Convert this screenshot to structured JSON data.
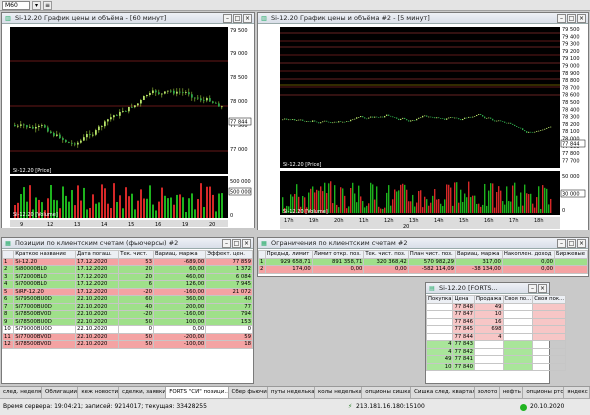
{
  "toolbar": {
    "timeframe": "M60"
  },
  "chart1": {
    "title": "Si-12.20 График цены и объёма - [60 минут]",
    "price_label": "Si-12.20 [Price]",
    "volume_label": "Si-12.20 [Volume]",
    "price_ticks": [
      "79 500",
      "79 000",
      "78 500",
      "78 000",
      "77 500",
      "77 000"
    ],
    "current_price": "77 844",
    "price_tag": "78 000",
    "volume_ticks": [
      "500 000",
      "0"
    ],
    "volume_tag": "500 000",
    "time_ticks": [
      "9",
      "12",
      "13",
      "14",
      "15",
      "16",
      "19",
      "20"
    ]
  },
  "chart2": {
    "title": "Si-12.20 График цены и объёма #2 - [5 минут]",
    "price_label": "Si-12.20 [Price]",
    "volume_label": "Si-12.20 [Volume]",
    "price_ticks": [
      "79 500",
      "79 400",
      "79 300",
      "79 200",
      "79 100",
      "79 000",
      "78 900",
      "78 800",
      "78 700",
      "78 600",
      "78 500",
      "78 400",
      "78 300",
      "78 200",
      "78 100",
      "78 000",
      "77 900",
      "77 800",
      "77 700"
    ],
    "current_price": "77 844",
    "volume_ticks": [
      "50 000",
      "0"
    ],
    "volume_tag": "30 000",
    "time_ticks": [
      "17h",
      "19h",
      "20h",
      "11h",
      "12h",
      "13h",
      "14h",
      "15h",
      "16h",
      "17h",
      "18h"
    ],
    "time_date": "20"
  },
  "positions": {
    "title": "Позиции по клиентским счетам (фьючерсы) #2",
    "columns": [
      "",
      "Краткое название",
      "Дата погаш.",
      "Тек. чист.",
      "Вариац. маржа",
      "Эффект. цен."
    ],
    "rows": [
      {
        "n": "1",
        "name": "Si-12.20",
        "date": "17.12.2020",
        "qty": "53",
        "var": "-689,00",
        "eff": "77 859",
        "color": "red"
      },
      {
        "n": "2",
        "name": "Si80000BL0",
        "date": "17.12.2020",
        "qty": "20",
        "var": "60,00",
        "eff": "1 372",
        "color": "green"
      },
      {
        "n": "3",
        "name": "Si72000BL0",
        "date": "17.12.2020",
        "qty": "20",
        "var": "460,00",
        "eff": "6 084",
        "color": "green"
      },
      {
        "n": "4",
        "name": "Si70000BL0",
        "date": "17.12.2020",
        "qty": "6",
        "var": "126,00",
        "eff": "7 945",
        "color": "green"
      },
      {
        "n": "5",
        "name": "SiRF-12.20",
        "date": "17.12.2020",
        "qty": "-20",
        "var": "-160,00",
        "eff": "21 072",
        "color": "red"
      },
      {
        "n": "6",
        "name": "Si79500BU0D",
        "date": "22.10.2020",
        "qty": "60",
        "var": "360,00",
        "eff": "40",
        "color": "green"
      },
      {
        "n": "7",
        "name": "Si77000BU0D",
        "date": "22.10.2020",
        "qty": "40",
        "var": "200,00",
        "eff": "77",
        "color": "green"
      },
      {
        "n": "8",
        "name": "Si78500BV0D",
        "date": "22.10.2020",
        "qty": "-20",
        "var": "-160,00",
        "eff": "794",
        "color": "green"
      },
      {
        "n": "9",
        "name": "Si78500BU0D",
        "date": "22.10.2020",
        "qty": "50",
        "var": "100,00",
        "eff": "153",
        "color": "green"
      },
      {
        "n": "10",
        "name": "Si79000BU0D",
        "date": "22.10.2020",
        "qty": "0",
        "var": "0,00",
        "eff": "0",
        "color": "none"
      },
      {
        "n": "11",
        "name": "Si77000BV0D",
        "date": "22.10.2020",
        "qty": "50",
        "var": "-200,00",
        "eff": "59",
        "color": "red"
      },
      {
        "n": "12",
        "name": "Si78500BV0D",
        "date": "22.10.2020",
        "qty": "50",
        "var": "-100,00",
        "eff": "18",
        "color": "red"
      }
    ]
  },
  "limits": {
    "title": "Ограничения по клиентским счетам #2",
    "columns": [
      "",
      "Предыд. лимит",
      "Лимит откр. поз.",
      "Тек. чист. поз.",
      "План чист. поз.",
      "Вариац. маржа",
      "Накоплен. доход",
      "Биржевые"
    ],
    "rows": [
      {
        "n": "1",
        "c1": "929 658,71",
        "c2": "891 358,71",
        "c3": "320 368,42",
        "c4": "570 982,29",
        "c5": "317,00",
        "c6": "0,00",
        "c7": "",
        "color": "green"
      },
      {
        "n": "2",
        "c1": "174,00",
        "c2": "0,00",
        "c3": "0,00",
        "c4": "-582 114,09",
        "c5": "-38 134,00",
        "c6": "0,00",
        "c7": "",
        "color": "red"
      }
    ]
  },
  "orderbook": {
    "title": "Si-12.20 [FORTS...",
    "columns": [
      "Покупка",
      "Цена",
      "Продажа",
      "Своя по...",
      "Своя пок..."
    ],
    "rows": [
      {
        "buy": "",
        "price": "77 848",
        "sell": "49",
        "color": "red"
      },
      {
        "buy": "",
        "price": "77 847",
        "sell": "10",
        "color": "red"
      },
      {
        "buy": "",
        "price": "77 846",
        "sell": "16",
        "color": "red"
      },
      {
        "buy": "",
        "price": "77 845",
        "sell": "698",
        "color": "red"
      },
      {
        "buy": "",
        "price": "77 844",
        "sell": "4",
        "color": "red"
      },
      {
        "buy": "4",
        "price": "77 843",
        "sell": "",
        "color": "green"
      },
      {
        "buy": "4",
        "price": "77 842",
        "sell": "",
        "color": "green"
      },
      {
        "buy": "49",
        "price": "77 841",
        "sell": "",
        "color": "green"
      },
      {
        "buy": "10",
        "price": "77 840",
        "sell": "",
        "color": "green"
      }
    ]
  },
  "tabs": [
    "след. неделя",
    "Облигации",
    "кеж новости",
    "сделки, заявки",
    "FORTS \"СИ\" позици...",
    "Сбер фьючи",
    "путы неделька",
    "колы неделька",
    "опционы сишка",
    "Сишка след. квартал",
    "золото",
    "нефть",
    "опционы ртс",
    "яндекс"
  ],
  "status": {
    "server_time": "Время сервера: 19:04:21; записей: 9214017; текущая: 33428255",
    "ip": "213.181.16.180:15100",
    "date": "20.10.2020"
  }
}
